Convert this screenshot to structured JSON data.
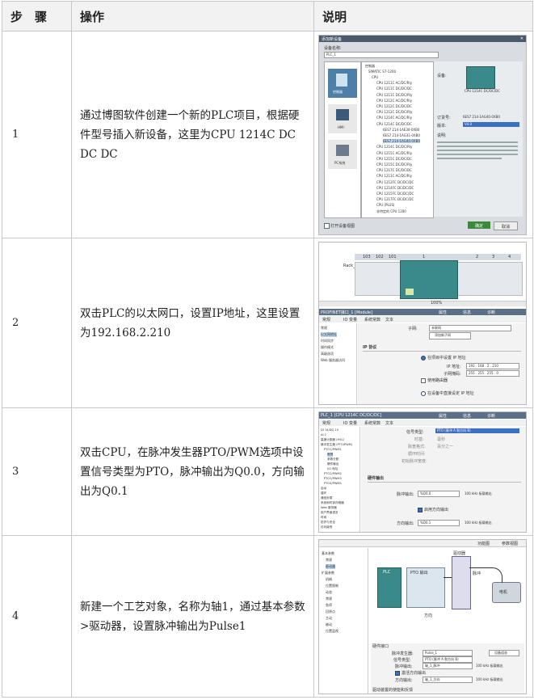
{
  "headers": {
    "step": "步　骤",
    "operation": "操作",
    "explanation": "说明"
  },
  "rows": [
    {
      "step": "1",
      "text": "通过博图软件创建一个新的PLC项目，根据硬件型号插入新设备，这里为CPU 1214C DC DC DC"
    },
    {
      "step": "2",
      "text": "双击PLC的以太网口，设置IP地址，这里设置为192.168.2.210"
    },
    {
      "step": "3",
      "text": "双击CPU，在脉冲发生器PTO/PWM选项中设置信号类型为PTO，脉冲输出为Q0.0，方向输出为Q0.1"
    },
    {
      "step": "4",
      "text": "新建一个工艺对象，名称为轴1，通过基本参数>驱动器，设置脉冲输出为Pulse1"
    }
  ],
  "shot1": {
    "title": "添加新设备",
    "device_name_label": "设备名称:",
    "device_name_value": "PLC_1",
    "left_buttons": [
      "控制器",
      "HMI",
      "PC系统"
    ],
    "tree": [
      "控制器",
      "SIMATIC S7-1200",
      "CPU",
      "CPU 1211C AC/DC/Rly",
      "CPU 1211C DC/DC/DC",
      "CPU 1211C DC/DC/Rly",
      "CPU 1212C AC/DC/Rly",
      "CPU 1212C DC/DC/DC",
      "CPU 1212C DC/DC/Rly",
      "CPU 1214C AC/DC/Rly",
      "CPU 1214C DC/DC/DC",
      "6ES7 214-1AE30-0XB0",
      "6ES7 214-1AG31-0XB0",
      "6ES7 214-1AG40-0XB0",
      "CPU 1214C DC/DC/Rly",
      "CPU 1215C AC/DC/Rly",
      "CPU 1215C DC/DC/DC",
      "CPU 1215C DC/DC/Rly",
      "CPU 1217C DC/DC/DC",
      "CPU 1211C AC/DC/Rly",
      "CPU 1212FC DC/DC/DC",
      "CPU 1214FC DC/DC/DC",
      "CPU 1215FC DC/DC/DC",
      "CPU 1217FC DC/DC/DC",
      "CPU (PLUS)",
      "非特定的 CPU 1200"
    ],
    "device_label": "设备:",
    "device_value": "CPU 1214C DC/DC/DC",
    "order_label": "订货号:",
    "order_value": "6ES7 214-1AG40-0XB0",
    "version_label": "版本:",
    "version_value": "V4.0",
    "desc_label": "说明:",
    "open_view": "打开设备视图",
    "ok": "确定",
    "cancel": "取消"
  },
  "shot2": {
    "rack_label": "Rack_0",
    "slots": [
      "103",
      "102",
      "101",
      "1",
      "2",
      "3",
      "4"
    ],
    "zoom": "100%",
    "title": "PROFINET接口_1 [Module]",
    "tabs": [
      "常规",
      "IO 变量",
      "系统常数",
      "文本"
    ],
    "props": [
      "属性",
      "信息",
      "诊断"
    ],
    "nav": [
      "常规",
      "以太网地址",
      "时间同步",
      "操作模式",
      "高级选项",
      "Web 服务器访问"
    ],
    "subnet_label": "子网:",
    "subnet_value": "未联网",
    "add_subnet": "添加新子网",
    "ip_section": "IP 协议",
    "opt_project": "在项目中设置 IP 地址",
    "ip_label": "IP 地址:",
    "ip_value": "192 . 168 . 2 . 210",
    "mask_label": "子网掩码:",
    "mask_value": "255 . 255 . 255 . 0",
    "router_label": "使用路由器",
    "opt_direct": "在设备中直接设定 IP 地址"
  },
  "shot3": {
    "title": "PLC_1 [CPU 1214C DC/DC/DC]",
    "tabs": [
      "常规",
      "IO 变量",
      "系统常数",
      "文本"
    ],
    "props": [
      "属性",
      "信息",
      "诊断"
    ],
    "nav": [
      "DI 14/DQ 10",
      "AI 2",
      "高速计数器 (HSC)",
      "脉冲发生器 (PTO/PWM)",
      "PTO1/PWM1",
      "常规",
      "参数分配",
      "硬件输出",
      "I/O 地址",
      "PTO2/PWM2",
      "PTO3/PWM3",
      "PTO4/PWM4",
      "启动",
      "循环",
      "通信负载",
      "系统和时钟存储器",
      "Web 服务器",
      "用户界面语言",
      "时间",
      "防护与安全",
      "访问级别"
    ],
    "signal_type_label": "信号类型:",
    "signal_type_value": "PTO (脉冲 A 和方向 B)",
    "time_base_label": "时基:",
    "time_base_value": "毫秒",
    "pulse_fmt_label": "脉宽格式:",
    "pulse_fmt_value": "百分之一",
    "cycle_label": "循环时间:",
    "init_label": "初始脉冲宽度:",
    "hw_output": "硬件输出",
    "pulse_out_label": "脉冲输出:",
    "pulse_out_value": "%Q0.0",
    "freq": "100 kHz 板载输出",
    "enable_dir": "启用方向输出",
    "dir_out_label": "方向输出:",
    "dir_out_value": "%Q0.1"
  },
  "shot4": {
    "tabs": [
      "功能图",
      "参数视图"
    ],
    "nav": [
      "基本参数",
      "常规",
      "驱动器",
      "扩展参数",
      "机械",
      "位置限制",
      "动态",
      "常规",
      "急停",
      "回原点",
      "主动",
      "被动",
      "位置监视"
    ],
    "labels": {
      "plc": "PLC",
      "pto": "PTO 输出",
      "driver": "驱动器",
      "pulse": "脉冲",
      "direction": "方向",
      "motor": "电机"
    },
    "hw_interface": "硬件接口",
    "pulse_gen_label": "脉冲发生器:",
    "pulse_gen_value": "Pulse_1",
    "signal_type_label": "信号类型:",
    "signal_type_value": "PTO (脉冲 A 和方向 B)",
    "pulse_out_label": "脉冲输出:",
    "pulse_out_value": "轴_1_脉冲",
    "enable_dir": "激活方向输出",
    "dir_out_label": "方向输出:",
    "dir_out_value": "轴_1_方向",
    "device_config": "设备组态",
    "onboard": "100 kHz 板载输出",
    "enable_out": "驱动装置的使能和反馈"
  }
}
